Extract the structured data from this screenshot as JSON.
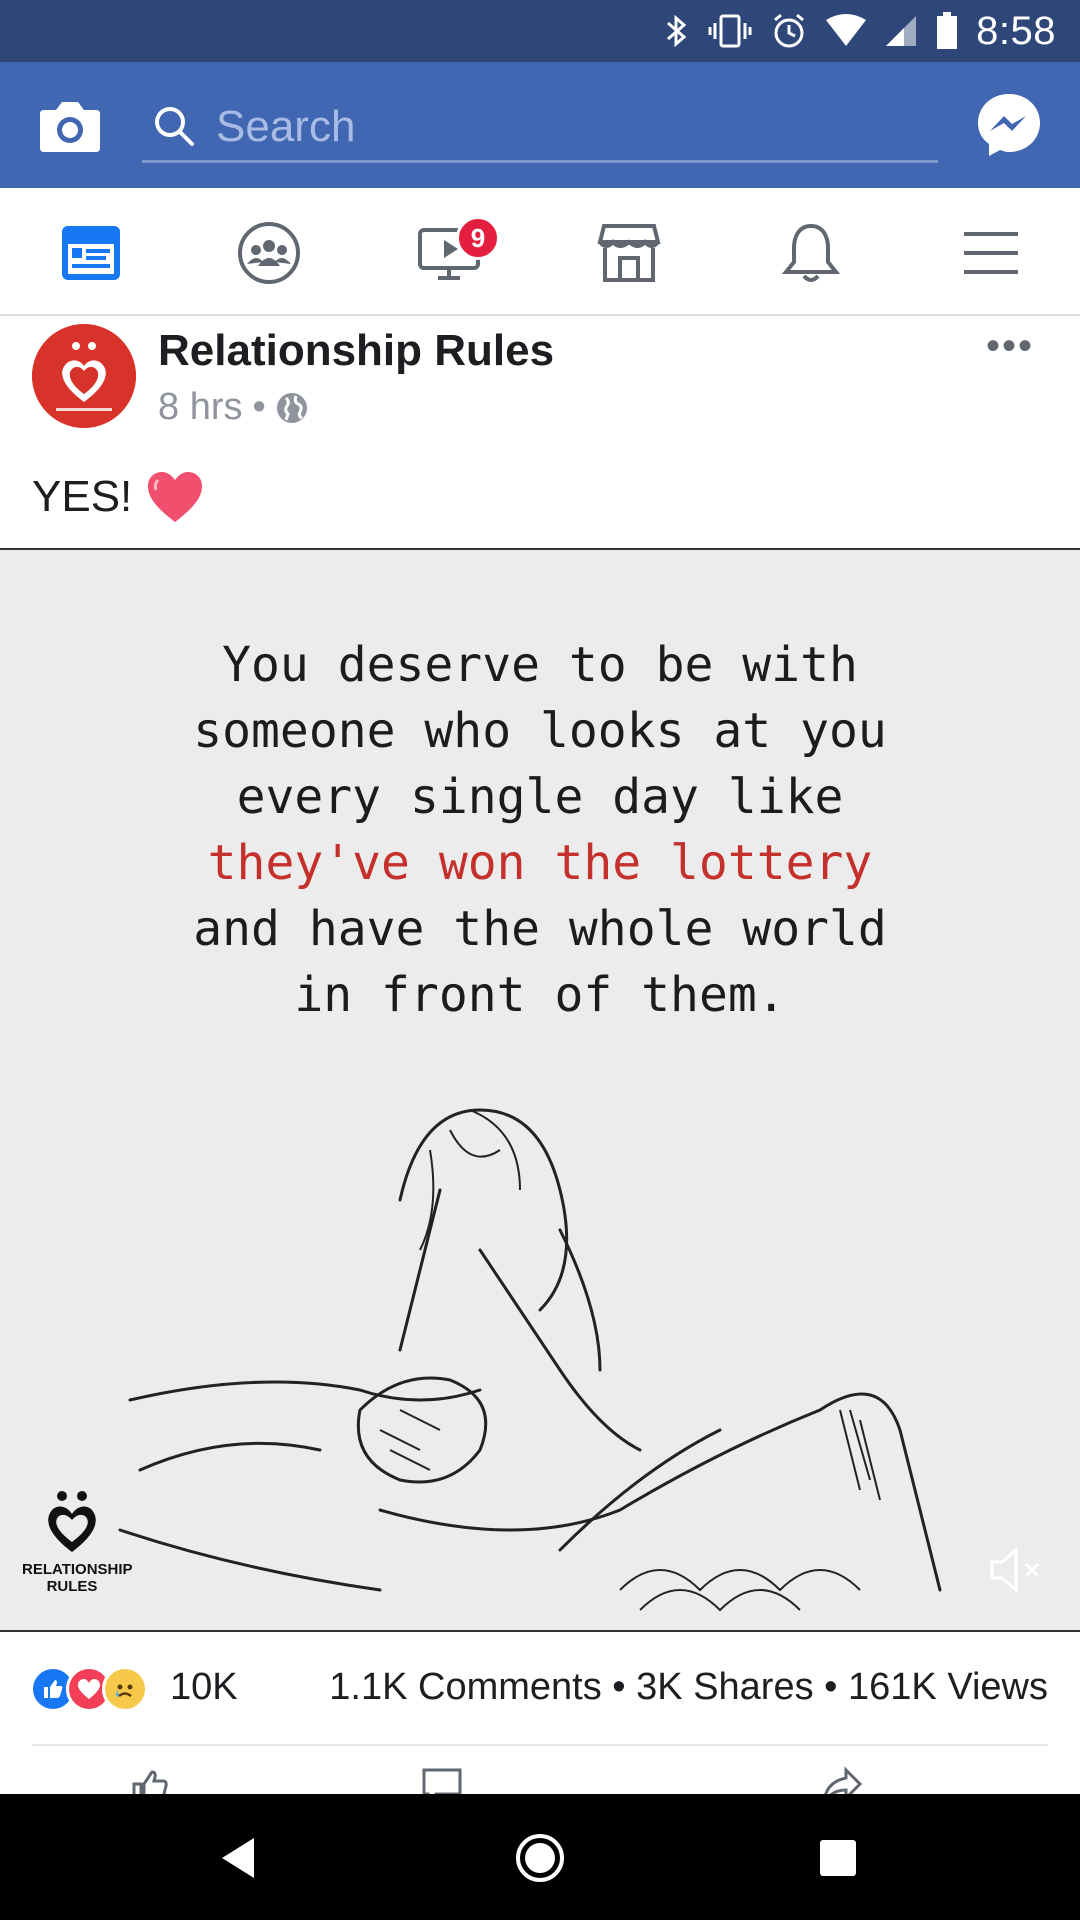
{
  "status_bar": {
    "time": "8:58"
  },
  "search": {
    "placeholder": "Search"
  },
  "nav": {
    "items": [
      "news-feed",
      "groups",
      "watch",
      "marketplace",
      "notifications",
      "menu"
    ],
    "watch_badge": "9"
  },
  "post": {
    "page_name": "Relationship Rules",
    "time": "8 hrs",
    "separator": "•",
    "caption": "YES!",
    "quote_lines": [
      "You deserve to be with",
      "someone who looks at you",
      "every single day like",
      "they've won the lottery",
      "and have the whole world",
      "in front of them."
    ],
    "watermark": "RELATIONSHIP RULES"
  },
  "stats": {
    "reactions_count": "10K",
    "summary": "1.1K Comments • 3K Shares • 161K Views"
  },
  "colors": {
    "status_bar": "#2f4679",
    "brand": "#4267b2",
    "badge": "#e41e3f",
    "quote_highlight": "#c4302b"
  }
}
